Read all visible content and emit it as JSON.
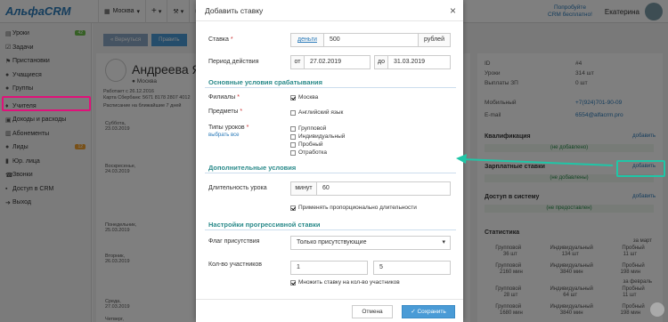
{
  "app": {
    "logo": "АльфаCRM"
  },
  "topbar": {
    "branch": "Москва",
    "plus": "+",
    "promo_line1": "Попробуйте",
    "promo_line2": "CRM бесплатно!",
    "user_name": "Екатерина"
  },
  "sidebar": {
    "items": [
      {
        "label": "Уроки",
        "icon": "calendar-icon",
        "badge": "42"
      },
      {
        "label": "Задачи",
        "icon": "tasks-icon"
      },
      {
        "label": "Пристановки",
        "icon": "flag-icon"
      },
      {
        "label": "Учащиеся",
        "icon": "student-icon"
      },
      {
        "label": "Группы",
        "icon": "group-icon"
      },
      {
        "label": "Учителя",
        "icon": "teacher-icon"
      },
      {
        "label": "Доходы и расходы",
        "icon": "money-icon"
      },
      {
        "label": "Абонементы",
        "icon": "ticket-icon"
      },
      {
        "label": "Лиды",
        "icon": "lead-icon",
        "badge": "12"
      },
      {
        "label": "Юр. лица",
        "icon": "building-icon"
      },
      {
        "label": "Звонки",
        "icon": "phone-icon"
      },
      {
        "label": "Доступ в CRM",
        "icon": "lock-icon"
      },
      {
        "label": "Выход",
        "icon": "exit-icon"
      }
    ]
  },
  "background": {
    "back_button": "« Вернуться",
    "edit_button": "Править",
    "profile_name": "Андреева Яро",
    "city": "Москва",
    "work_since": "Работает с 26.12.2016",
    "card": "Карта Сбербанк: 5671 8178 2807 4012",
    "schedule_title": "Расписание на ближайшие 7 дней",
    "days": [
      {
        "name": "Суббота,",
        "date": "23.03.2019"
      },
      {
        "name": "Воскресенье,",
        "date": "24.03.2019"
      },
      {
        "name": "Понедельник,",
        "date": "25.03.2019"
      },
      {
        "name": "Вторник,",
        "date": "26.03.2019"
      },
      {
        "name": "Среда,",
        "date": "27.03.2019"
      },
      {
        "name": "Четверг,",
        "date": ""
      }
    ],
    "right": {
      "id_label": "ID",
      "id_value": "#4",
      "lessons_label": "Уроки",
      "lessons_value": "314 шт",
      "pay_label": "Выплаты ЗП",
      "pay_value": "0 шт",
      "mobile_label": "Мобильный",
      "mobile_value": "+7(924)701-90-09",
      "email_label": "E-mail",
      "email_value": "6554@alfacrm.pro",
      "qual_title": "Квалификация",
      "qual_link": "добавить",
      "qual_status": "(не добавлено)",
      "salary_title": "Зарплатные ставки",
      "salary_link": "добавить",
      "salary_status": "(не добавлены)",
      "access_title": "Доступ в систему",
      "access_link": "добавить",
      "access_status": "(не предоставлен)",
      "stats_title": "Статистика",
      "stats_period1": "за март",
      "stats_period2": "за февраль",
      "stats_cols": [
        "Групповой",
        "Индивидуальный",
        "Пробный"
      ],
      "stats_row1": [
        "36 шт",
        "134 шт",
        "11 шт"
      ],
      "stats_row2": [
        "2160 мин",
        "3840 мин",
        "198 мин"
      ],
      "stats_row3": [
        "28 шт",
        "64 шт",
        "11 шт"
      ],
      "stats_row4": [
        "1680 мин",
        "3840 мин",
        "198 мин"
      ]
    }
  },
  "modal": {
    "title": "Добавить ставку",
    "rate_label": "Ставка",
    "rate_currency_link": "деньги",
    "rate_value": "500",
    "rate_unit": "рублей",
    "period_label": "Период действия",
    "from_label": "от",
    "from_value": "27.02.2019",
    "to_label": "до",
    "to_value": "31.03.2019",
    "section_main": "Основные условия срабатывания",
    "branches_label": "Филиалы",
    "branches": [
      {
        "label": "Москва",
        "checked": true
      }
    ],
    "subjects_label": "Предметы",
    "subjects": [
      {
        "label": "Английский язык",
        "checked": false
      }
    ],
    "lesson_types_label": "Типы уроков",
    "select_all_link": "выбрать все",
    "lesson_types": [
      {
        "label": "Групповой",
        "checked": false
      },
      {
        "label": "Индивидуальный",
        "checked": false
      },
      {
        "label": "Пробный",
        "checked": false
      },
      {
        "label": "Отработка",
        "checked": false
      }
    ],
    "section_extra": "Дополнительные условия",
    "duration_label": "Длительность урока",
    "duration_unit": "минут",
    "duration_value": "60",
    "proportional_label": "Применять пропорционально длительности",
    "proportional_checked": true,
    "section_progressive": "Настройки прогрессивной ставки",
    "attendance_label": "Флаг присутствия",
    "attendance_value": "Только присутствующие",
    "participants_label": "Кол-во участников",
    "participants_from": "1",
    "participants_to": "5",
    "multiply_label": "Множить ставку на кол-во участников",
    "multiply_checked": true,
    "cancel_button": "Отмена",
    "save_button": "Сохранить"
  },
  "colors": {
    "accent": "#2a7ab9",
    "section": "#2a8a8a",
    "highlight_pink": "#e0117a",
    "annotation_teal": "#1fc6a7",
    "primary_button": "#4a9bd6"
  }
}
